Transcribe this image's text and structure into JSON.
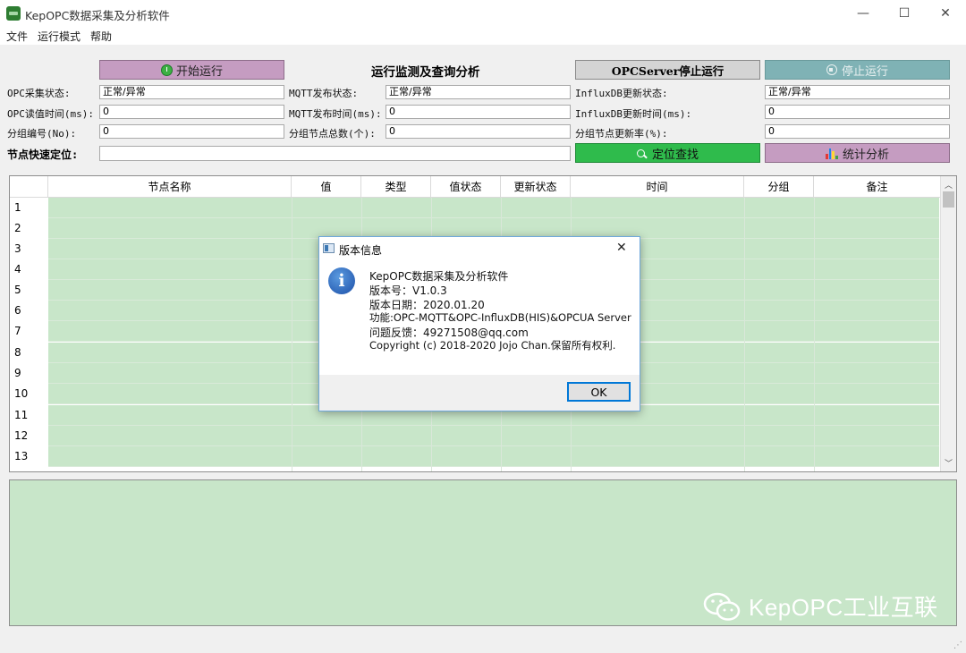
{
  "window": {
    "title": "KepOPC数据采集及分析软件",
    "min_glyph": "—",
    "max_glyph": "☐",
    "close_glyph": "✕"
  },
  "menu": [
    "文件",
    "运行模式",
    "帮助"
  ],
  "toolbar": {
    "start_label": "开始运行",
    "center_title": "运行监测及查询分析",
    "opcserver_stop_label": "OPCServer停止运行",
    "stop_label": "停止运行",
    "locate_label": "定位查找",
    "stats_label": "统计分析"
  },
  "status": {
    "opc_state_label": "OPC采集状态:",
    "opc_state_value": "正常/异常",
    "mqtt_state_label": "MQTT发布状态:",
    "mqtt_state_value": "正常/异常",
    "influx_state_label": "InfluxDB更新状态:",
    "influx_state_value": "正常/异常",
    "opc_read_time_label": "OPC读值时间(ms):",
    "opc_read_time_value": "0",
    "mqtt_pub_time_label": "MQTT发布时间(ms):",
    "mqtt_pub_time_value": "0",
    "influx_update_time_label": "InfluxDB更新时间(ms):",
    "influx_update_time_value": "0",
    "group_no_label": "分组编号(No):",
    "group_no_value": "0",
    "group_node_total_label": "分组节点总数(个):",
    "group_node_total_value": "0",
    "group_node_rate_label": "分组节点更新率(%):",
    "group_node_rate_value": "0",
    "quick_locate_label": "节点快速定位:",
    "quick_locate_value": ""
  },
  "table": {
    "columns": [
      "节点名称",
      "值",
      "类型",
      "值状态",
      "更新状态",
      "时间",
      "分组",
      "备注"
    ],
    "row_numbers": [
      "1",
      "2",
      "3",
      "4",
      "5",
      "6",
      "7",
      "8",
      "9",
      "10",
      "11",
      "12",
      "13"
    ]
  },
  "dialog": {
    "title": "版本信息",
    "lines": [
      "KepOPC数据采集及分析软件",
      "版本号：V1.0.3",
      "版本日期：2020.01.20",
      "功能:OPC-MQTT&OPC-InfluxDB(HIS)&OPCUA Server",
      "问题反馈：49271508@qq.com",
      "Copyright (c) 2018-2020 Jojo Chan.保留所有权利."
    ],
    "ok_label": "OK",
    "close_glyph": "✕"
  },
  "watermark": {
    "text": "KepOPC工业互联"
  },
  "colors": {
    "grid_green": "#c8e6c9",
    "btn_purple": "#c59cc1",
    "btn_teal": "#7fb2b5",
    "btn_green": "#2fbb4c",
    "dialog_border": "#6fa8dc"
  }
}
